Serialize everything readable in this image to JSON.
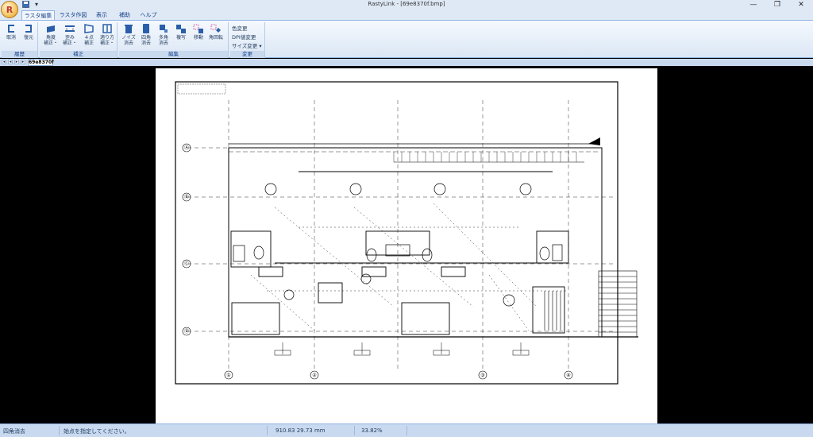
{
  "titlebar": {
    "orb_letter": "R",
    "window_title": "RastyLink - [69e8370f.bmp]",
    "minimize": "—",
    "restore": "❐",
    "close": "✕"
  },
  "tabs": [
    "ラスタ編集",
    "ラスタ作図",
    "表示",
    "補助",
    "ヘルプ"
  ],
  "ribbon": {
    "history": {
      "label": "履歴",
      "undo": "取消",
      "redo": "復元"
    },
    "correction": {
      "label": "補正",
      "skew_l1": "角度",
      "skew_l2": "補正・",
      "distort_l1": "歪み",
      "distort_l2": "補正・",
      "fourpt_l1": "４点",
      "fourpt_l2": "補正",
      "fit_l1": "適り方",
      "fit_l2": "補正・"
    },
    "edit": {
      "label": "編集",
      "noise_l1": "ノイズ",
      "noise_l2": "消去",
      "rect_l1": "四角",
      "rect_l2": "消去",
      "poly_l1": "多角",
      "poly_l2": "消去",
      "copy": "複写",
      "move": "移動",
      "rotate": "角回転"
    },
    "change": {
      "label": "変更",
      "color": "色変更",
      "dpi": "DPI値変更",
      "size": "サイズ変更"
    }
  },
  "doc_tab": "69e8370f",
  "status": {
    "mode": "四角消去",
    "prompt": "始点を指定してください。",
    "coords": "910.83  29.73 mm",
    "zoom": "33.82%"
  },
  "drawing": {
    "row_markers": [
      "Ⓐ",
      "Ⓑ",
      "Ⓒ",
      "Ⓓ"
    ],
    "col_markers": [
      "①",
      "②",
      "③",
      "④"
    ]
  },
  "colors": {
    "ribbon_text": "#15428b",
    "accent": "#8db2e3",
    "workspace": "#000000"
  }
}
